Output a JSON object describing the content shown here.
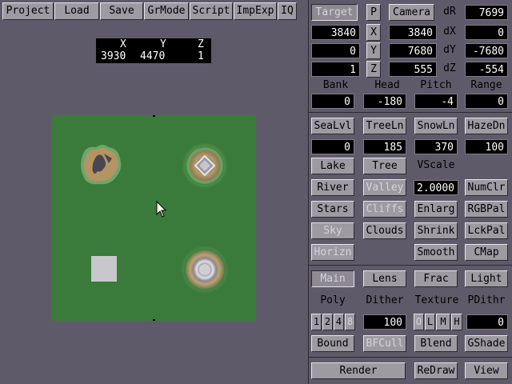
{
  "menu": [
    "Project",
    "Load",
    "Save",
    "GrMode",
    "Script",
    "ImpExp",
    "IQ"
  ],
  "cursor_readout": {
    "x_label": "X",
    "y_label": "Y",
    "z_label": "Z",
    "x": "3930",
    "y": "4470",
    "z": "1"
  },
  "camera": {
    "target_label": "Target",
    "p_label": "P",
    "camera_label": "Camera",
    "target_x": "3840",
    "target_y": "0",
    "target_z": "1",
    "axis_x": "X",
    "axis_y": "Y",
    "axis_z": "Z",
    "camera_x": "3840",
    "camera_y": "7680",
    "camera_z": "555",
    "dr_label": "dR",
    "dx_label": "dX",
    "dy_label": "dY",
    "dz_label": "dZ",
    "dr": "7699",
    "dx": "0",
    "dy": "-7680",
    "dz": "-554"
  },
  "orientation": {
    "bank_label": "Bank",
    "head_label": "Head",
    "pitch_label": "Pitch",
    "range_label": "Range",
    "bank": "0",
    "head": "-180",
    "pitch": "-4",
    "range": "0"
  },
  "levels": {
    "sealvl_label": "SeaLvl",
    "treeln_label": "TreeLn",
    "snowln_label": "SnowLn",
    "hazedn_label": "HazeDn",
    "sealvl": "0",
    "treeln": "185",
    "snowln": "370",
    "hazedn": "100"
  },
  "features": {
    "lake": "Lake",
    "tree": "Tree",
    "vscale_label": "VScale",
    "vscale": "2.0000",
    "river": "River",
    "valley": "Valley",
    "numclr": "NumClr",
    "stars": "Stars",
    "cliffs": "Cliffs",
    "enlarg": "Enlarg",
    "rgbpal": "RGBPal",
    "sky": "Sky",
    "clouds": "Clouds",
    "shrink": "Shrink",
    "lckpal": "LckPal",
    "horizn": "Horizn",
    "smooth": "Smooth",
    "cmap": "CMap"
  },
  "modes": {
    "main": "Main",
    "lens": "Lens",
    "frac": "Frac",
    "light": "Light"
  },
  "render_opts": {
    "poly_label": "Poly",
    "dither_label": "Dither",
    "texture_label": "Texture",
    "pdithr_label": "PDithr",
    "poly_opts": [
      "1",
      "2",
      "4",
      "8"
    ],
    "dither": "100",
    "texture_opts": [
      "O",
      "L",
      "M",
      "H"
    ],
    "pdithr": "0",
    "bound": "Bound",
    "bfcull": "BFCull",
    "blend": "Blend",
    "gshade": "GShade"
  },
  "actions": {
    "render": "Render",
    "redraw": "ReDraw",
    "view": "View"
  },
  "colors": {
    "background": "#5f5a6a",
    "terrain": "#3a7a3a",
    "button": "#9d9aa2"
  }
}
